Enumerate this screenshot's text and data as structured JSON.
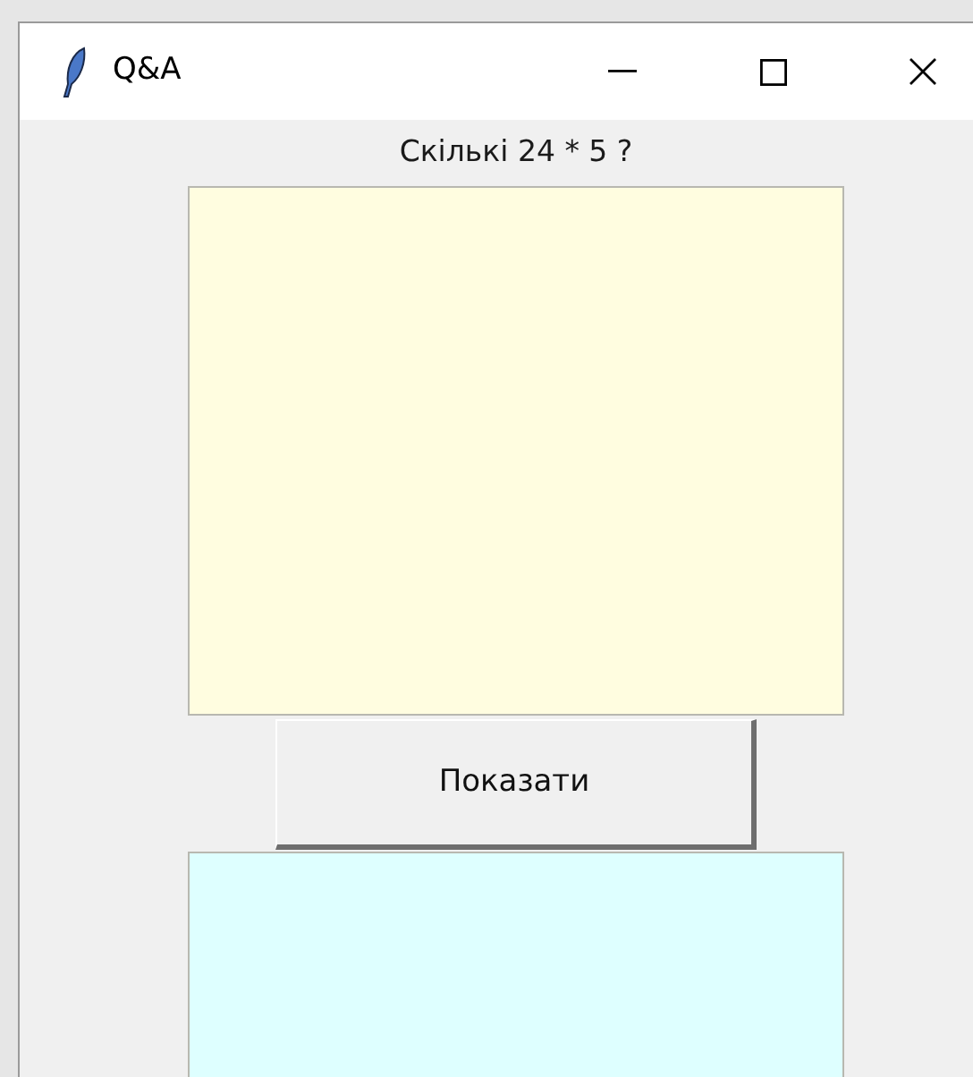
{
  "window": {
    "title": "Q&A"
  },
  "question": "Скількі 24 * 5 ?",
  "show_button": {
    "label": "Показати"
  }
}
